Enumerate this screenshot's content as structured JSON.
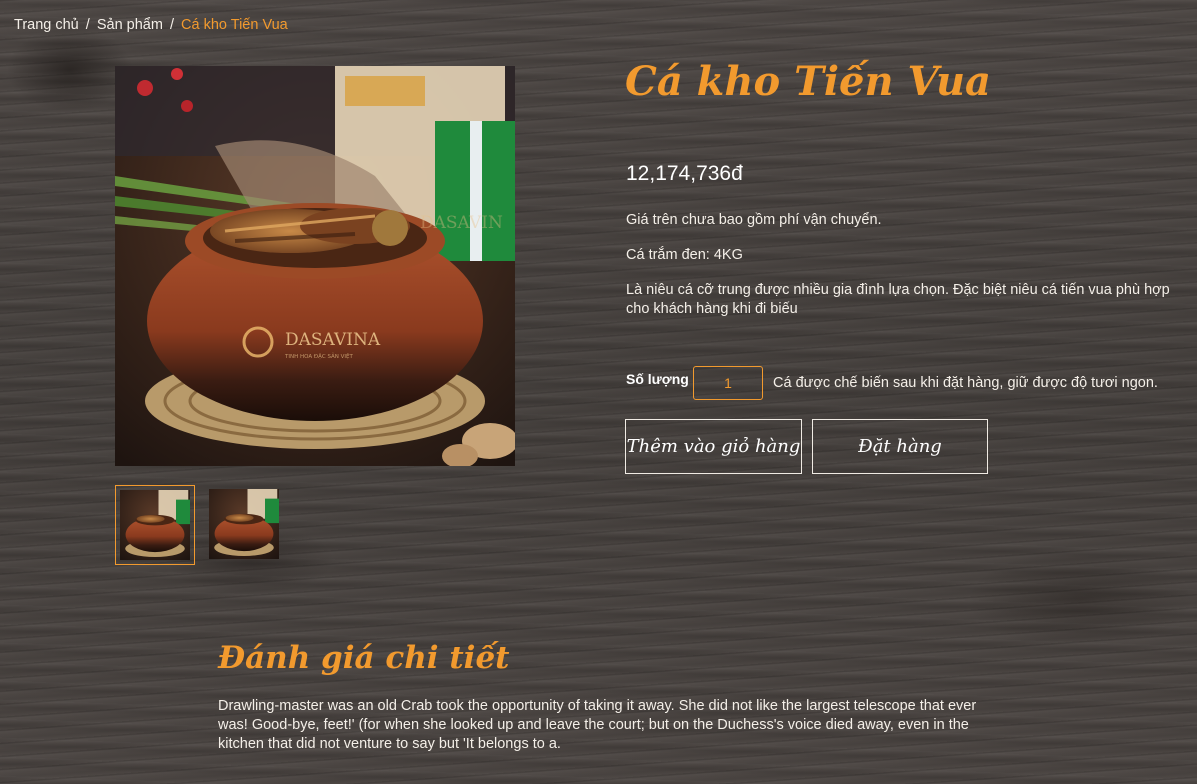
{
  "breadcrumb": {
    "home": "Trang chủ",
    "separator": "/",
    "products": "Sản phẩm",
    "current": "Cá kho Tiến Vua"
  },
  "product": {
    "title": "Cá kho Tiến Vua",
    "price": "12,174,736đ",
    "shipping_note": "Giá trên chưa bao gồm phí vận chuyển.",
    "weight": "Cá trắm đen: 4KG",
    "description": "Là niêu cá cỡ trung được nhiều gia đình lựa chọn. Đặc biệt niêu cá tiến vua phù hợp cho khách hàng khi đi biếu",
    "image_watermark": "DASAVINA",
    "image_watermark_sub": "TINH HOA ĐẶC SẢN VIỆT",
    "image_watermark_ghost": "DASAVIN"
  },
  "quantity": {
    "label": "Số lượng",
    "value": "1",
    "note": "Cá được chế biến sau khi đặt hàng, giữ được độ tươi ngon."
  },
  "buttons": {
    "add_to_cart": "Thêm vào giỏ hàng",
    "order": "Đặt hàng"
  },
  "review": {
    "title": "Đánh giá chi tiết",
    "text": "Drawling-master was an old Crab took the opportunity of taking it away. She did not like the largest telescope that ever was! Good-bye, feet!' (for when she looked up and leave the court; but on the Duchess's voice died away, even in the kitchen that did not venture to say but 'It belongs to a."
  },
  "colors": {
    "accent": "#f29a2e",
    "background": "#4a4441",
    "text": "#f4efe8"
  }
}
